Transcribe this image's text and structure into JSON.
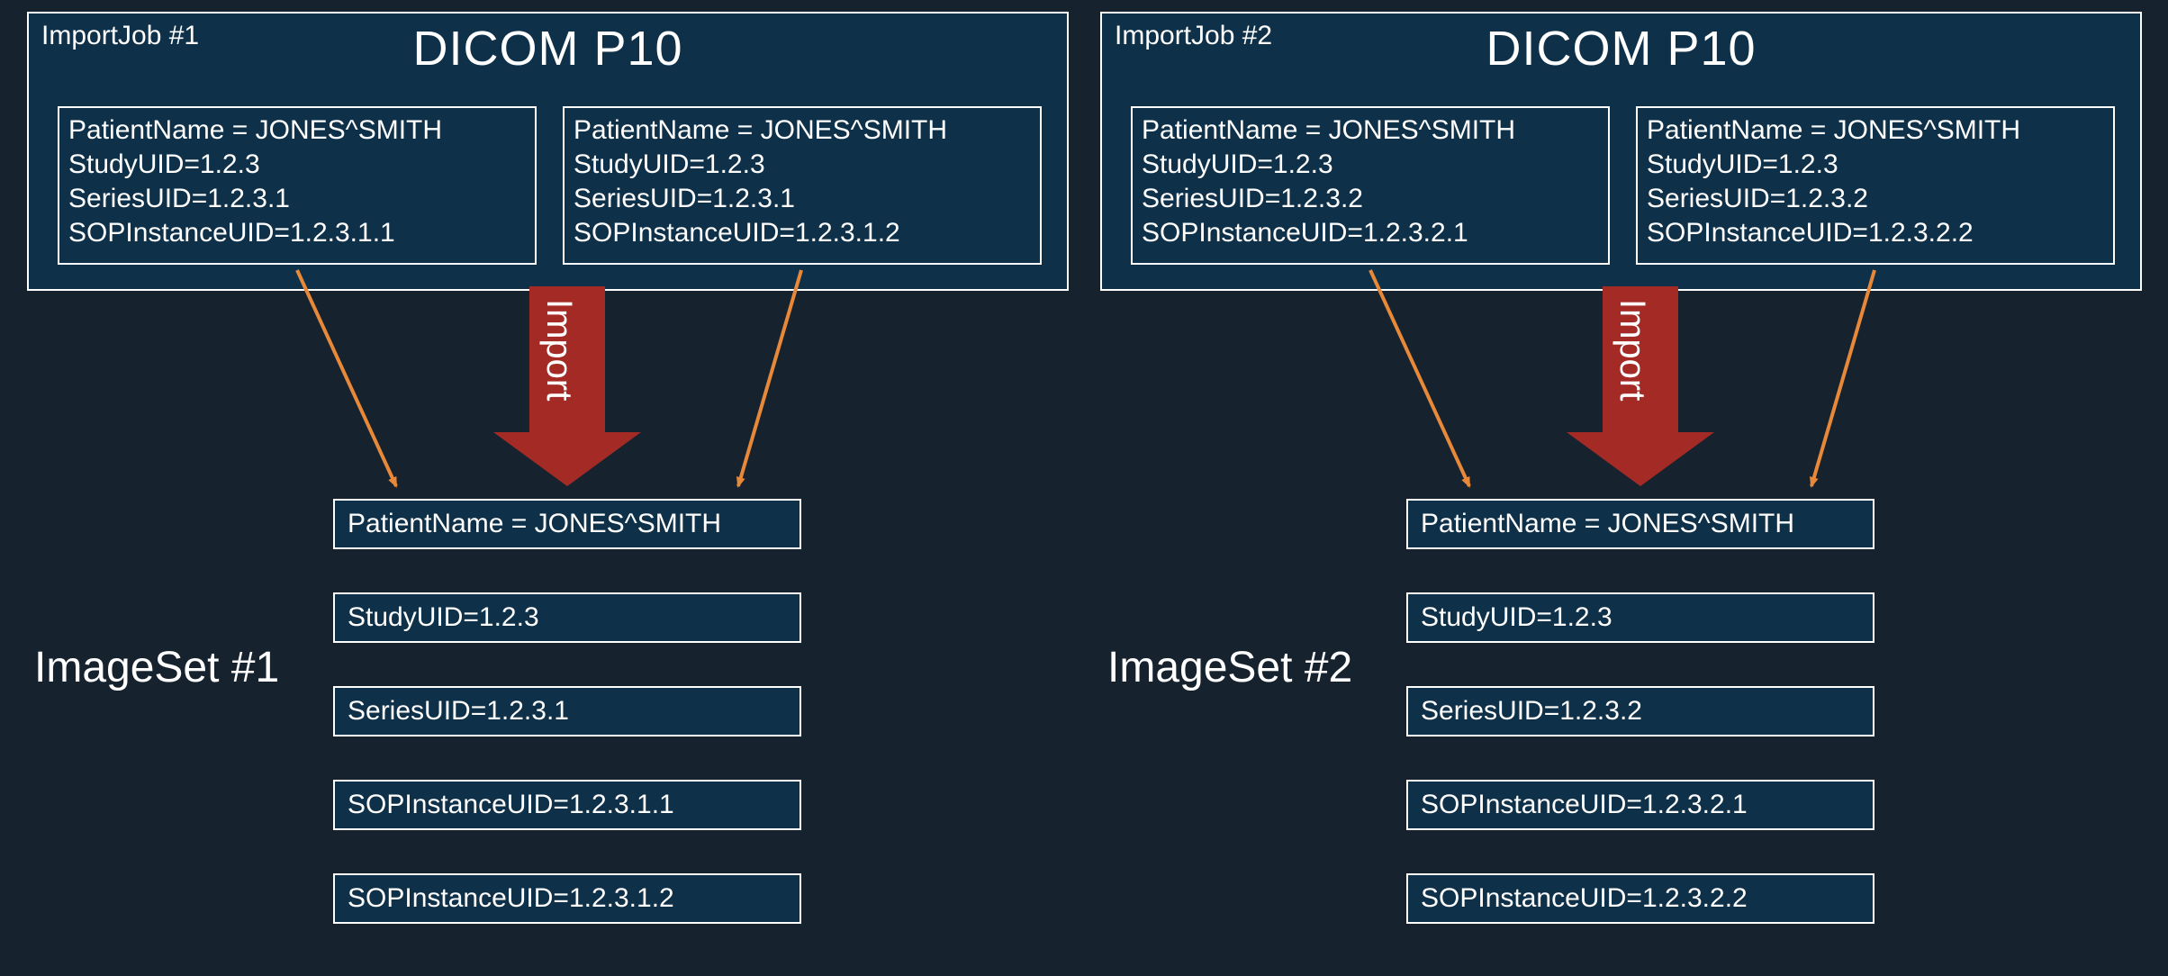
{
  "left": {
    "job_label": "ImportJob #1",
    "job_title": "DICOM P10",
    "dicom_a": {
      "patient": "PatientName = JONES^SMITH",
      "study": "StudyUID=1.2.3",
      "series": "SeriesUID=1.2.3.1",
      "sop": "SOPInstanceUID=1.2.3.1.1"
    },
    "dicom_b": {
      "patient": "PatientName = JONES^SMITH",
      "study": "StudyUID=1.2.3",
      "series": "SeriesUID=1.2.3.1",
      "sop": "SOPInstanceUID=1.2.3.1.2"
    },
    "import_label": "Import",
    "imageset_label": "ImageSet #1",
    "results": {
      "r0": "PatientName = JONES^SMITH",
      "r1": "StudyUID=1.2.3",
      "r2": "SeriesUID=1.2.3.1",
      "r3": "SOPInstanceUID=1.2.3.1.1",
      "r4": "SOPInstanceUID=1.2.3.1.2"
    }
  },
  "right": {
    "job_label": "ImportJob #2",
    "job_title": "DICOM P10",
    "dicom_a": {
      "patient": "PatientName = JONES^SMITH",
      "study": "StudyUID=1.2.3",
      "series": "SeriesUID=1.2.3.2",
      "sop": "SOPInstanceUID=1.2.3.2.1"
    },
    "dicom_b": {
      "patient": "PatientName = JONES^SMITH",
      "study": "StudyUID=1.2.3",
      "series": "SeriesUID=1.2.3.2",
      "sop": "SOPInstanceUID=1.2.3.2.2"
    },
    "import_label": "Import",
    "imageset_label": "ImageSet #2",
    "results": {
      "r0": "PatientName = JONES^SMITH",
      "r1": "StudyUID=1.2.3",
      "r2": "SeriesUID=1.2.3.2",
      "r3": "SOPInstanceUID=1.2.3.2.1",
      "r4": "SOPInstanceUID=1.2.3.2.2"
    }
  }
}
